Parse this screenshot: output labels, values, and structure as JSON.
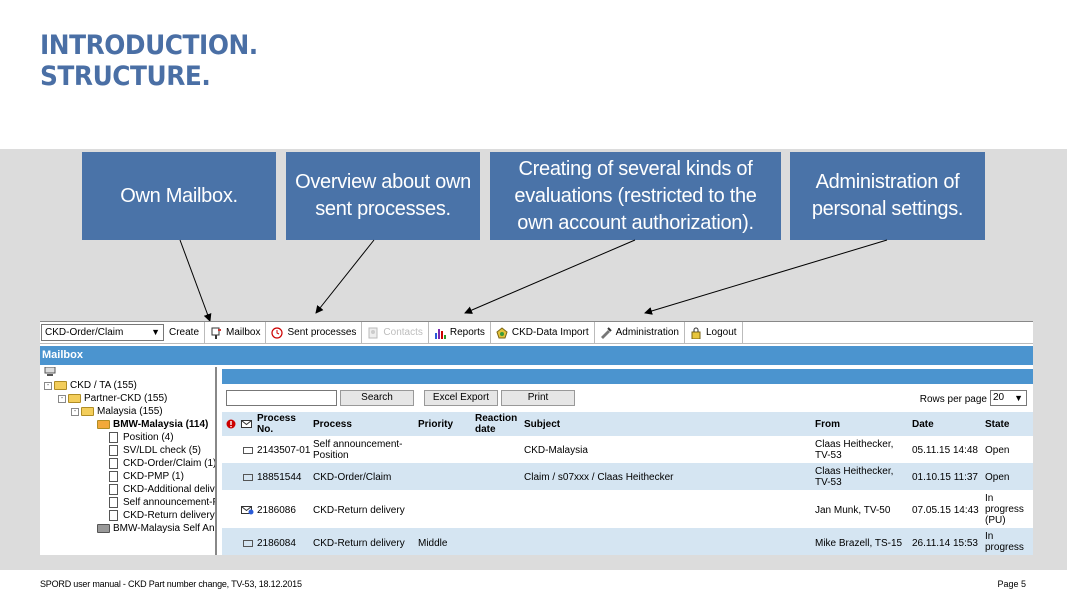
{
  "slide": {
    "title_line1": "INTRODUCTION.",
    "title_line2": "STRUCTURE.",
    "footer_left": "SPORD user manual - CKD Part number change, TV-53, 18.12.2015",
    "footer_right": "Page 5"
  },
  "callouts": [
    {
      "text": "Own Mailbox."
    },
    {
      "text": "Overview about own sent processes."
    },
    {
      "text": "Creating of several kinds of evaluations (restricted to the own account authorization)."
    },
    {
      "text": "Administration of personal settings."
    }
  ],
  "toolbar": {
    "select_value": "CKD-Order/Claim",
    "create": "Create",
    "mailbox": "Mailbox",
    "sent": "Sent processes",
    "contacts": "Contacts",
    "reports": "Reports",
    "import": "CKD-Data Import",
    "admin": "Administration",
    "logout": "Logout"
  },
  "mailbox_bar": "Mailbox",
  "tree": [
    {
      "label": "CKD / TA (155)"
    },
    {
      "label": "Partner-CKD (155)"
    },
    {
      "label": "Malaysia (155)"
    },
    {
      "label": "BMW-Malaysia (114)"
    },
    {
      "label": "Position (4)"
    },
    {
      "label": "SV/LDL check (5)"
    },
    {
      "label": "CKD-Order/Claim (1)"
    },
    {
      "label": "CKD-PMP (1)"
    },
    {
      "label": "CKD-Additional delive"
    },
    {
      "label": "Self announcement-F"
    },
    {
      "label": "CKD-Return delivery"
    },
    {
      "label": "BMW-Malaysia Self Ann"
    }
  ],
  "list": {
    "search_btn": "Search",
    "excel_btn": "Excel Export",
    "print_btn": "Print",
    "rows_per_page_label": "Rows per page",
    "rows_per_page_value": "20",
    "headers": {
      "process_no": "Process No.",
      "process": "Process",
      "priority": "Priority",
      "reaction": "Reaction date",
      "subject": "Subject",
      "from": "From",
      "date": "Date",
      "state": "State"
    },
    "rows": [
      {
        "process_no": "2143507-01",
        "process": "Self announcement-Position",
        "priority": "",
        "subject": "CKD-Malaysia",
        "from": "Claas Heithecker, TV-53",
        "date": "05.11.15 14:48",
        "state": "Open"
      },
      {
        "process_no": "18851544",
        "process": "CKD-Order/Claim",
        "priority": "",
        "subject": "Claim / s07xxx / Claas Heithecker",
        "from": "Claas Heithecker, TV-53",
        "date": "01.10.15 11:37",
        "state": "Open"
      },
      {
        "process_no": "2186086",
        "process": "CKD-Return delivery",
        "priority": "",
        "subject": "",
        "from": "Jan Munk, TV-50",
        "date": "07.05.15 14:43",
        "state": "In progress (PU)"
      },
      {
        "process_no": "2186084",
        "process": "CKD-Return delivery",
        "priority": "Middle",
        "subject": "",
        "from": "Mike Brazell, TS-15",
        "date": "26.11.14 15:53",
        "state": "In progress"
      }
    ]
  }
}
